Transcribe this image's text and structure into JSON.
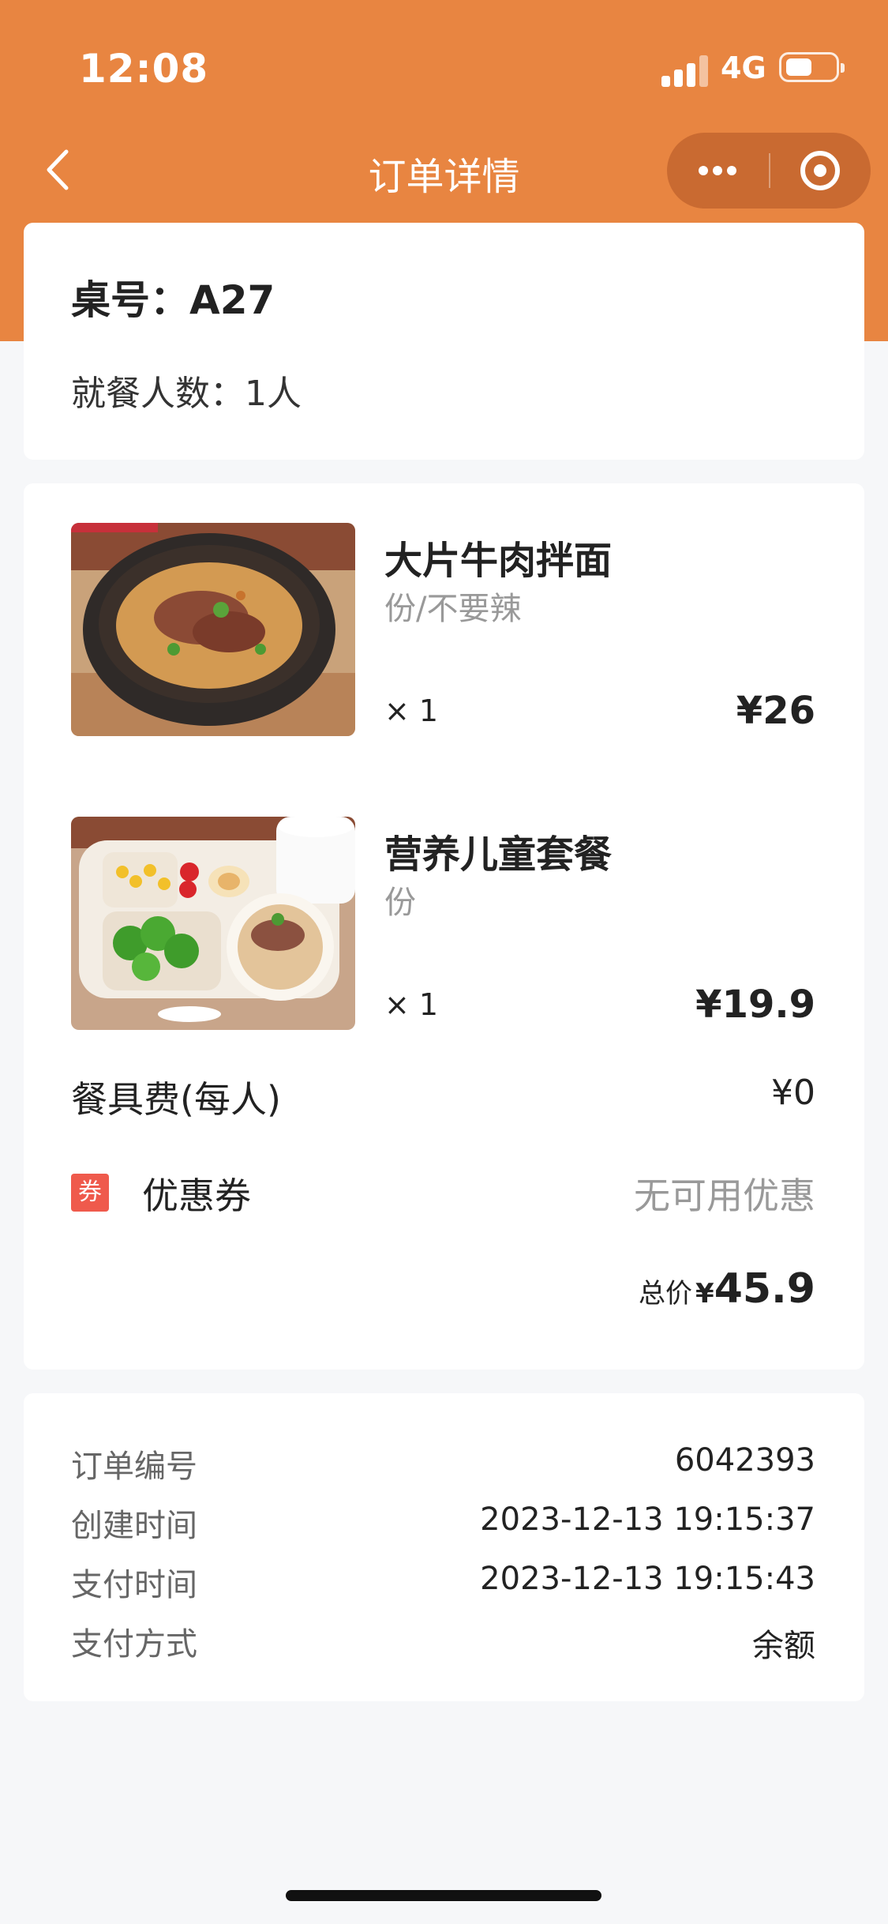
{
  "status_bar": {
    "time": "12:08",
    "network": "4G"
  },
  "nav": {
    "title": "订单详情"
  },
  "table": {
    "number": "桌号：A27",
    "diners": "就餐人数：1人"
  },
  "items": [
    {
      "name": "大片牛肉拌面",
      "spec": "份/不要辣",
      "qty": "× 1",
      "price": "¥26",
      "image": "beef-noodle-photo"
    },
    {
      "name": "营养儿童套餐",
      "spec": "份",
      "qty": "× 1",
      "price": "¥19.9",
      "image": "kids-meal-photo"
    }
  ],
  "fees": {
    "tableware_label": "餐具费(每人)",
    "tableware_value": "¥0"
  },
  "coupon": {
    "tag": "券",
    "label": "优惠券",
    "value": "无可用优惠"
  },
  "total": {
    "label": "总价",
    "currency": "¥",
    "amount": "45.9"
  },
  "info": [
    {
      "label": "订单编号",
      "value": "6042393"
    },
    {
      "label": "创建时间",
      "value": "2023-12-13 19:15:37"
    },
    {
      "label": "支付时间",
      "value": "2023-12-13 19:15:43"
    },
    {
      "label": "支付方式",
      "value": "余额"
    }
  ],
  "colors": {
    "header": "#e88541",
    "coupon_tag": "#ef5a4c",
    "capsule": "#c96a31"
  }
}
